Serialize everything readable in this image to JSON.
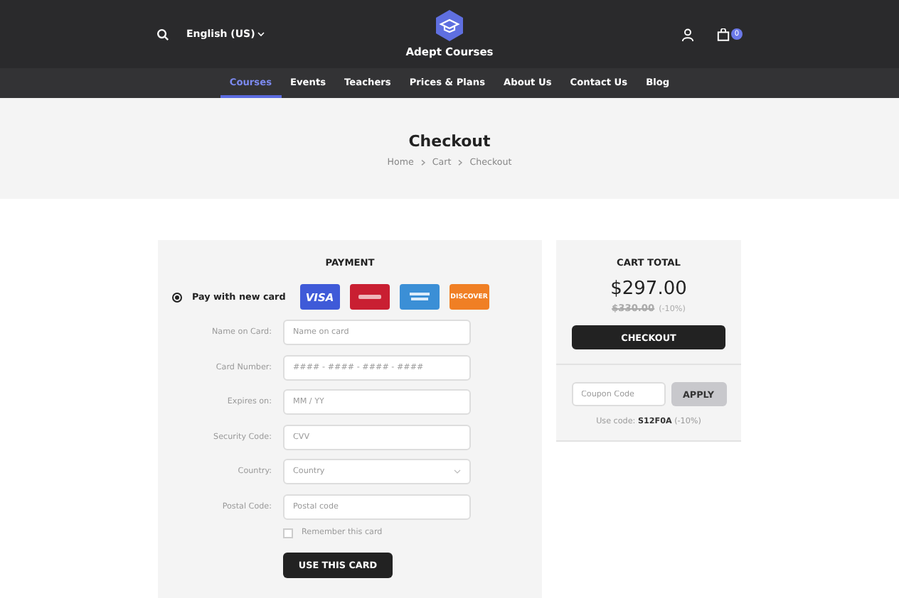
{
  "header": {
    "language": "English (US)",
    "brand": "Adept Courses",
    "cart_count": "0"
  },
  "nav": [
    {
      "label": "Courses",
      "selected": true
    },
    {
      "label": "Events",
      "selected": false
    },
    {
      "label": "Teachers",
      "selected": false
    },
    {
      "label": "Prices & Plans",
      "selected": false
    },
    {
      "label": "About Us",
      "selected": false
    },
    {
      "label": "Contact Us",
      "selected": false
    },
    {
      "label": "Blog",
      "selected": false
    }
  ],
  "hero": {
    "title": "Checkout",
    "breadcrumb": [
      "Home",
      "Cart",
      "Checkout"
    ]
  },
  "payment": {
    "title": "PAYMENT",
    "method": {
      "label": "Pay with new card",
      "selected": true
    },
    "cards": [
      {
        "kind": "visa",
        "label": "VISA",
        "color": "#3f5ad8"
      },
      {
        "kind": "mastercard",
        "color": "#c91f32"
      },
      {
        "kind": "amex",
        "color": "#3b8fd6"
      },
      {
        "kind": "discover",
        "label": "DISCOVER",
        "color": "#f07f24"
      }
    ],
    "fields": [
      {
        "kind": "text",
        "label": "Name on Card:",
        "placeholder": "Name on card"
      },
      {
        "kind": "text",
        "label": "Card Number:",
        "placeholder": "#### - #### - #### - ####"
      },
      {
        "kind": "text",
        "label": "Expires on:",
        "placeholder": "MM / YY"
      },
      {
        "kind": "text",
        "label": "Security Code:",
        "placeholder": "CVV"
      },
      {
        "kind": "select",
        "label": "Country:",
        "placeholder": "Country"
      },
      {
        "kind": "text",
        "label": "Postal Code:",
        "placeholder": "Postal code"
      }
    ],
    "remember": {
      "label": "Remember this card",
      "checked": false
    },
    "submit": "USE THIS CARD"
  },
  "cart": {
    "title": "CART TOTAL",
    "total": "$297.00",
    "old_price": "$330.00",
    "discount": "(-10%)",
    "checkout": "CHECKOUT",
    "coupon_placeholder": "Coupon Code",
    "apply": "APPLY",
    "hint": "Use code: **S12F0A** (-10%)"
  }
}
